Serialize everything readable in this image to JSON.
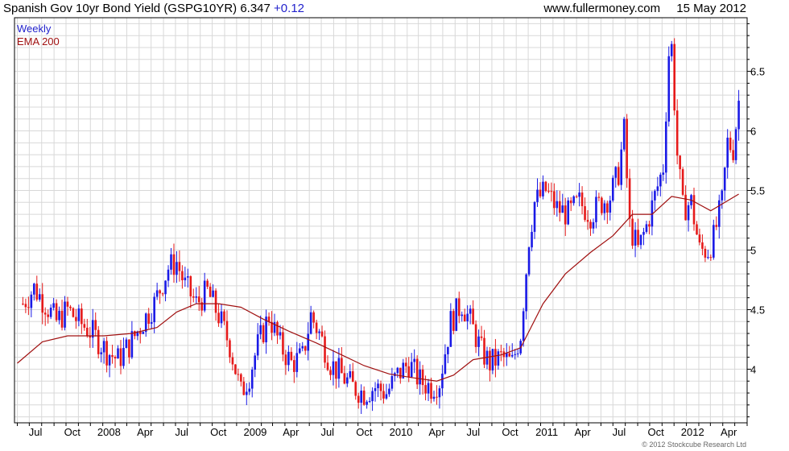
{
  "header": {
    "title": "Spanish Gov 10yr Bond Yield (GSPG10YR)",
    "last": "6.347",
    "change": "+0.12",
    "site": "www.fullermoney.com",
    "date": "15 May 2012"
  },
  "copyright": "© 2012 Stockcube Research Ltd",
  "colors": {
    "up": "#1a1ae6",
    "down": "#e61a1a",
    "ema": "#a01010",
    "grid": "#d8d8d8",
    "axis": "#000000",
    "legend_weekly": "#2222cc",
    "legend_ema": "#a01010"
  },
  "chart_data": {
    "type": "candlestick",
    "frequency": "weekly",
    "ylim": [
      3.55,
      6.95
    ],
    "y_ticks": [
      4,
      4.5,
      5,
      5.5,
      6,
      6.5
    ],
    "y_tick_labels": [
      "4",
      "4.5",
      "5",
      "5.5",
      "6",
      "6.5"
    ],
    "y_axis_side": "right",
    "grid": true,
    "legend_position": "top-left",
    "x_labels": [
      "Jul",
      "Oct",
      "2008",
      "Apr",
      "Jul",
      "Oct",
      "2009",
      "Apr",
      "Jul",
      "Oct",
      "2010",
      "Apr",
      "Jul",
      "Oct",
      "2011",
      "Apr",
      "Jul",
      "Oct",
      "2012",
      "Apr"
    ],
    "series": [
      {
        "name": "Weekly",
        "kind": "price",
        "anchors": [
          [
            "2007-06-15",
            4.55
          ],
          [
            "2007-07-13",
            4.68
          ],
          [
            "2007-08-10",
            4.55
          ],
          [
            "2007-09-07",
            4.4
          ],
          [
            "2007-10-05",
            4.5
          ],
          [
            "2007-11-02",
            4.4
          ],
          [
            "2007-12-07",
            4.3
          ],
          [
            "2008-01-11",
            4.15
          ],
          [
            "2008-02-08",
            4.08
          ],
          [
            "2008-03-07",
            4.2
          ],
          [
            "2008-04-11",
            4.4
          ],
          [
            "2008-05-09",
            4.55
          ],
          [
            "2008-06-13",
            4.85
          ],
          [
            "2008-07-04",
            4.9
          ],
          [
            "2008-07-25",
            4.7
          ],
          [
            "2008-08-22",
            4.55
          ],
          [
            "2008-09-19",
            4.65
          ],
          [
            "2008-10-17",
            4.45
          ],
          [
            "2008-11-14",
            4.2
          ],
          [
            "2008-12-12",
            3.8
          ],
          [
            "2009-01-02",
            3.95
          ],
          [
            "2009-01-23",
            4.2
          ],
          [
            "2009-02-20",
            4.45
          ],
          [
            "2009-03-20",
            4.2
          ],
          [
            "2009-04-17",
            4.05
          ],
          [
            "2009-05-15",
            4.1
          ],
          [
            "2009-06-05",
            4.45
          ],
          [
            "2009-06-26",
            4.3
          ],
          [
            "2009-07-24",
            4.05
          ],
          [
            "2009-08-21",
            3.95
          ],
          [
            "2009-09-18",
            3.85
          ],
          [
            "2009-10-16",
            3.8
          ],
          [
            "2009-11-13",
            3.85
          ],
          [
            "2009-12-11",
            3.8
          ],
          [
            "2010-01-08",
            3.95
          ],
          [
            "2010-02-05",
            4.05
          ],
          [
            "2010-03-05",
            3.9
          ],
          [
            "2010-04-02",
            3.85
          ],
          [
            "2010-04-23",
            3.9
          ],
          [
            "2010-05-21",
            4.4
          ],
          [
            "2010-06-18",
            4.55
          ],
          [
            "2010-07-09",
            4.4
          ],
          [
            "2010-08-06",
            4.15
          ],
          [
            "2010-08-27",
            4.05
          ],
          [
            "2010-09-24",
            4.1
          ],
          [
            "2010-10-22",
            4.05
          ],
          [
            "2010-11-12",
            4.3
          ],
          [
            "2010-12-03",
            5.1
          ],
          [
            "2010-12-17",
            5.4
          ],
          [
            "2011-01-14",
            5.5
          ],
          [
            "2011-02-11",
            5.35
          ],
          [
            "2011-03-11",
            5.3
          ],
          [
            "2011-04-08",
            5.4
          ],
          [
            "2011-05-06",
            5.3
          ],
          [
            "2011-06-03",
            5.4
          ],
          [
            "2011-06-24",
            5.45
          ],
          [
            "2011-07-15",
            5.65
          ],
          [
            "2011-07-29",
            6.0
          ],
          [
            "2011-08-12",
            5.2
          ],
          [
            "2011-09-02",
            5.0
          ],
          [
            "2011-09-23",
            5.2
          ],
          [
            "2011-10-14",
            5.45
          ],
          [
            "2011-11-04",
            5.7
          ],
          [
            "2011-11-18",
            6.65
          ],
          [
            "2011-11-25",
            6.7
          ],
          [
            "2011-12-09",
            5.8
          ],
          [
            "2011-12-23",
            5.35
          ],
          [
            "2012-01-13",
            5.4
          ],
          [
            "2012-02-03",
            5.0
          ],
          [
            "2012-02-24",
            5.0
          ],
          [
            "2012-03-09",
            5.1
          ],
          [
            "2012-03-30",
            5.4
          ],
          [
            "2012-04-13",
            5.9
          ],
          [
            "2012-04-27",
            5.85
          ],
          [
            "2012-05-11",
            6.25
          ]
        ]
      },
      {
        "name": "EMA 200",
        "kind": "ema",
        "points": [
          [
            "2007-06-01",
            4.05
          ],
          [
            "2007-08-03",
            4.23
          ],
          [
            "2007-10-05",
            4.28
          ],
          [
            "2008-01-04",
            4.28
          ],
          [
            "2008-03-14",
            4.3
          ],
          [
            "2008-05-16",
            4.35
          ],
          [
            "2008-07-04",
            4.48
          ],
          [
            "2008-08-22",
            4.55
          ],
          [
            "2008-10-17",
            4.55
          ],
          [
            "2008-12-12",
            4.52
          ],
          [
            "2009-02-06",
            4.42
          ],
          [
            "2009-04-10",
            4.32
          ],
          [
            "2009-06-19",
            4.22
          ],
          [
            "2009-08-21",
            4.12
          ],
          [
            "2009-10-16",
            4.03
          ],
          [
            "2009-12-18",
            3.96
          ],
          [
            "2010-02-12",
            3.93
          ],
          [
            "2010-04-16",
            3.9
          ],
          [
            "2010-05-28",
            3.95
          ],
          [
            "2010-07-16",
            4.08
          ],
          [
            "2010-09-24",
            4.12
          ],
          [
            "2010-11-12",
            4.18
          ],
          [
            "2011-01-07",
            4.55
          ],
          [
            "2011-03-04",
            4.8
          ],
          [
            "2011-05-06",
            4.98
          ],
          [
            "2011-07-01",
            5.12
          ],
          [
            "2011-08-19",
            5.3
          ],
          [
            "2011-10-07",
            5.3
          ],
          [
            "2011-11-25",
            5.45
          ],
          [
            "2012-01-13",
            5.42
          ],
          [
            "2012-03-02",
            5.33
          ],
          [
            "2012-05-11",
            5.47
          ]
        ]
      }
    ]
  }
}
